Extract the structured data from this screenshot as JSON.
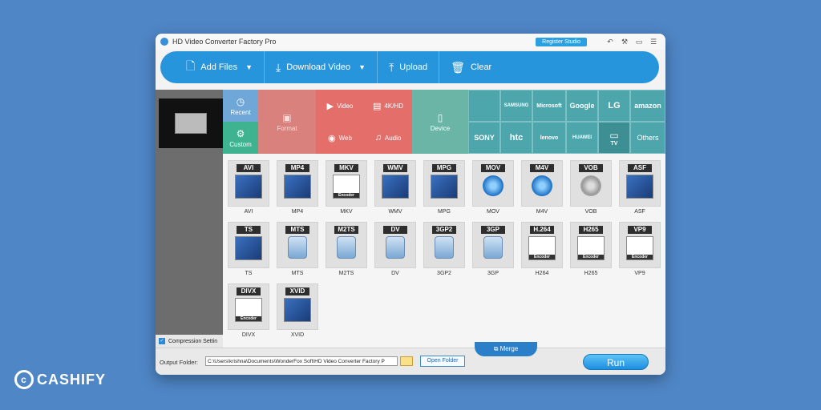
{
  "window": {
    "title": "HD Video Converter Factory Pro",
    "register_label": "Register Studio"
  },
  "toolbar": {
    "add_files": "Add Files",
    "download_video": "Download Video",
    "upload": "Upload",
    "clear": "Clear"
  },
  "left_panel": {
    "compression_label": "Compression Settin"
  },
  "categories": {
    "recent": "Recent",
    "custom": "Custom",
    "format": "Format",
    "video": "Video",
    "hd": "4K/HD",
    "web": "Web",
    "audio": "Audio",
    "device": "Device"
  },
  "brands": {
    "row1": [
      "",
      "SAMSUNG",
      "Microsoft",
      "Google",
      "LG",
      "amazon"
    ],
    "row2": [
      "SONY",
      "htc",
      "lenovo",
      "HUAWEI",
      "TV",
      "Others"
    ]
  },
  "formats": [
    {
      "tag": "AVI",
      "name": "AVI",
      "art": "pic"
    },
    {
      "tag": "MP4",
      "name": "MP4",
      "art": "pic"
    },
    {
      "tag": "MKV",
      "name": "MKV",
      "art": "enc"
    },
    {
      "tag": "WMV",
      "name": "WMV",
      "art": "pic"
    },
    {
      "tag": "MPG",
      "name": "MPG",
      "art": "pic"
    },
    {
      "tag": "MOV",
      "name": "MOV",
      "art": "qt"
    },
    {
      "tag": "M4V",
      "name": "M4V",
      "art": "qt"
    },
    {
      "tag": "VOB",
      "name": "VOB",
      "art": "disc"
    },
    {
      "tag": "ASF",
      "name": "ASF",
      "art": "pic"
    },
    {
      "tag": "TS",
      "name": "TS",
      "art": "pic"
    },
    {
      "tag": "MTS",
      "name": "MTS",
      "art": "cam"
    },
    {
      "tag": "M2TS",
      "name": "M2TS",
      "art": "cam"
    },
    {
      "tag": "DV",
      "name": "DV",
      "art": "cam"
    },
    {
      "tag": "3GP2",
      "name": "3GP2",
      "art": "cam"
    },
    {
      "tag": "3GP",
      "name": "3GP",
      "art": "cam"
    },
    {
      "tag": "H.264",
      "name": "H264",
      "art": "enc"
    },
    {
      "tag": "H265",
      "name": "H265",
      "art": "enc"
    },
    {
      "tag": "VP9",
      "name": "VP9",
      "art": "enc"
    },
    {
      "tag": "DIVX",
      "name": "DIVX",
      "art": "enc"
    },
    {
      "tag": "XVID",
      "name": "XVID",
      "art": "pic"
    }
  ],
  "encoder_label": "Encoder",
  "bottom": {
    "output_label": "Output Folder:",
    "output_path": "C:\\Users\\krishna\\Documents\\WonderFox Soft\\HD Video Converter Factory P",
    "open_folder": "Open Folder",
    "merge": "Merge",
    "run": "Run"
  },
  "watermark": "CASHIFY",
  "colors": {
    "background": "#4f86c6",
    "toolbar": "#2795dc",
    "category_blue": "#6fa8d8",
    "category_green": "#3fb38f",
    "category_red": "#d9817c",
    "category_teal": "#6ab5a6",
    "brand_teal": "#4ea6ad"
  }
}
